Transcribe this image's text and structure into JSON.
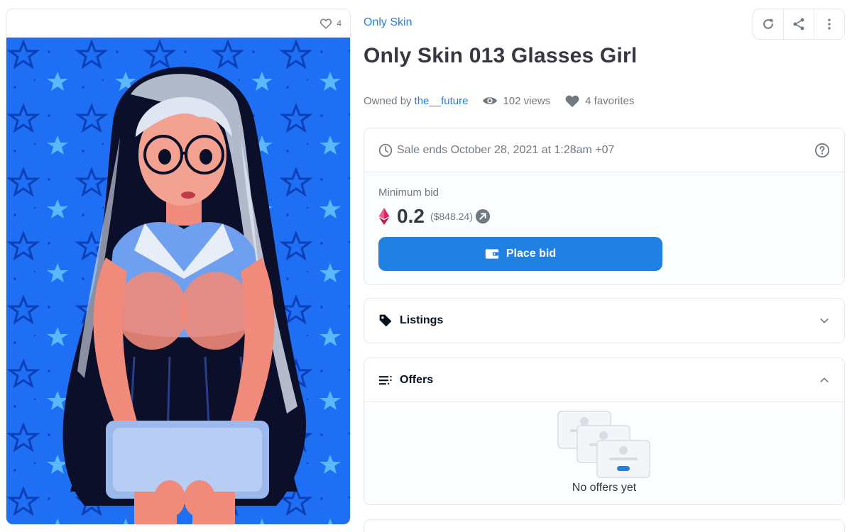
{
  "artwork": {
    "favorite_count": "4",
    "colors": {
      "background": "#1f6ff5",
      "star": "#5ab8ff",
      "star_dark": "#0a3fb8",
      "skin": "#f08a7a",
      "hair": "#0c0f2a"
    }
  },
  "item": {
    "collection": "Only Skin",
    "title": "Only Skin 013 Glasses Girl",
    "owned_by_label": "Owned by",
    "owner": "the__future",
    "views": "102 views",
    "favorites": "4 favorites"
  },
  "toolbar": {
    "icons": [
      "refresh-icon",
      "share-icon",
      "more-icon"
    ]
  },
  "sale": {
    "ends_text": "Sale ends October 28, 2021 at 1:28am +07",
    "min_bid_label": "Minimum bid",
    "price": "0.2",
    "price_usd": "($848.24)",
    "place_bid_label": "Place bid"
  },
  "listings": {
    "label": "Listings"
  },
  "offers": {
    "label": "Offers",
    "empty_text": "No offers yet"
  },
  "colors": {
    "accent": "#2081e2",
    "text": "#353840",
    "muted": "#707a83",
    "border": "#e5e8eb",
    "eth": "#e0245e"
  }
}
